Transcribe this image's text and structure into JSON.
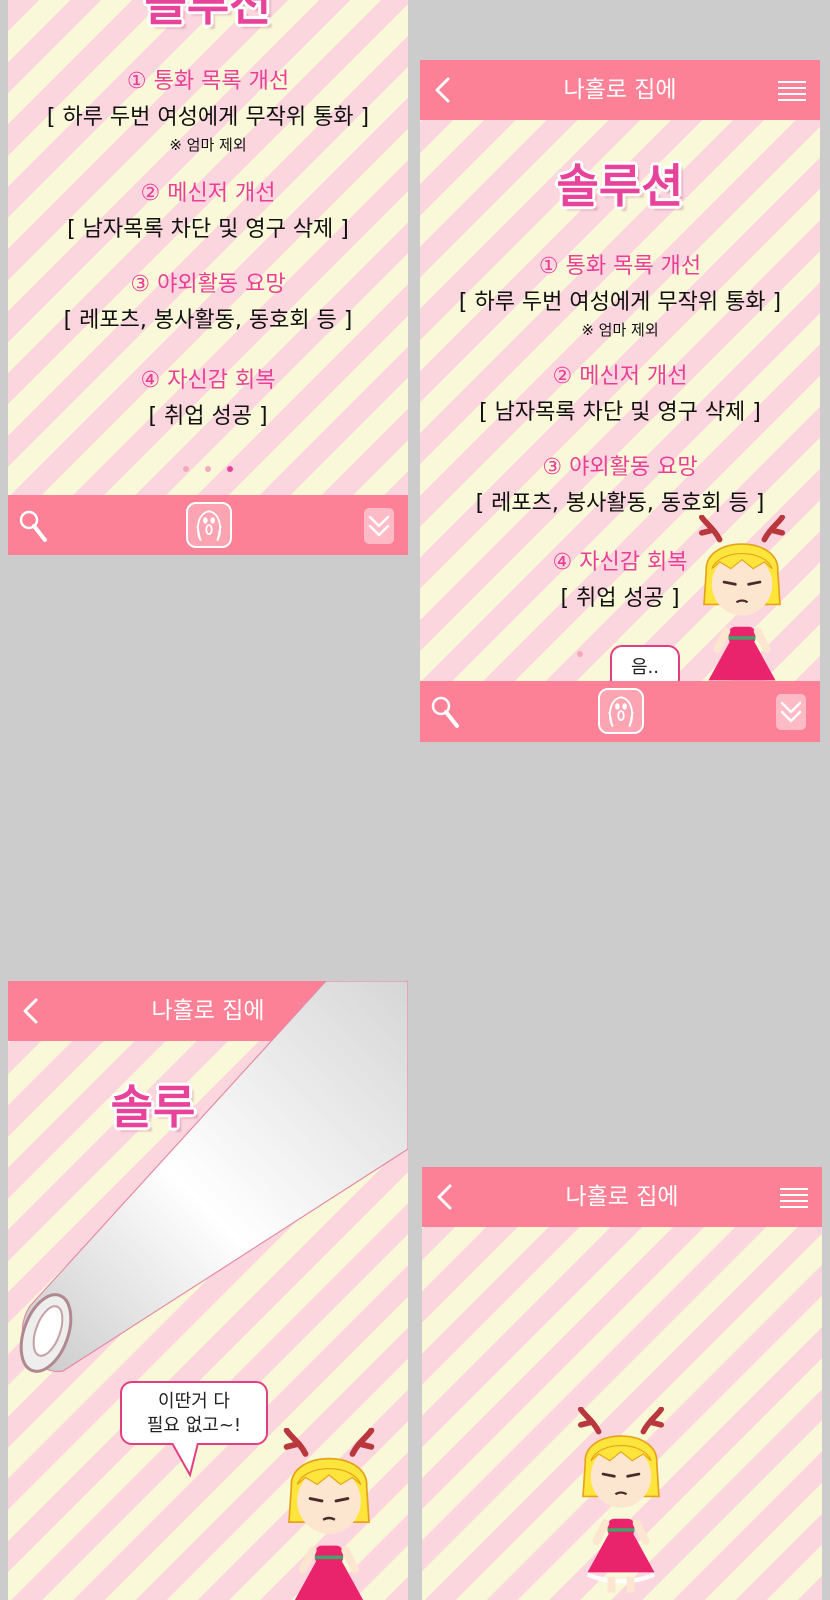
{
  "header": {
    "title": "나홀로 집에"
  },
  "solution": {
    "title": "솔루션",
    "title_partial": "솔루션",
    "title_cut": "솔루",
    "items": [
      {
        "heading": "① 통화 목록 개선",
        "detail": "[ 하루 두번 여성에게 무작위 통화 ]",
        "note": "※ 엄마 제외"
      },
      {
        "heading": "② 메신저 개선",
        "detail": "[ 남자목록 차단 및 영구 삭제 ]"
      },
      {
        "heading": "③ 야외활동 요망",
        "detail": "[ 레포츠, 봉사활동, 동호회 등 ]"
      },
      {
        "heading": "④ 자신감 회복",
        "detail": "[ 취업 성공 ]"
      }
    ]
  },
  "bubbles": {
    "hmm": "음..",
    "line1": "이딴거 다",
    "line2": "필요 없고~!"
  },
  "icons": [
    "back-icon",
    "menu-icon",
    "search-icon",
    "scream-icon",
    "double-chevron-down-icon",
    "page-dot-icon"
  ],
  "colors": {
    "bar": "#fd8196",
    "accent": "#e8439b",
    "stripe_pink": "#fbd6df",
    "stripe_cream": "#f9f9d9",
    "background": "#cdcccd"
  }
}
